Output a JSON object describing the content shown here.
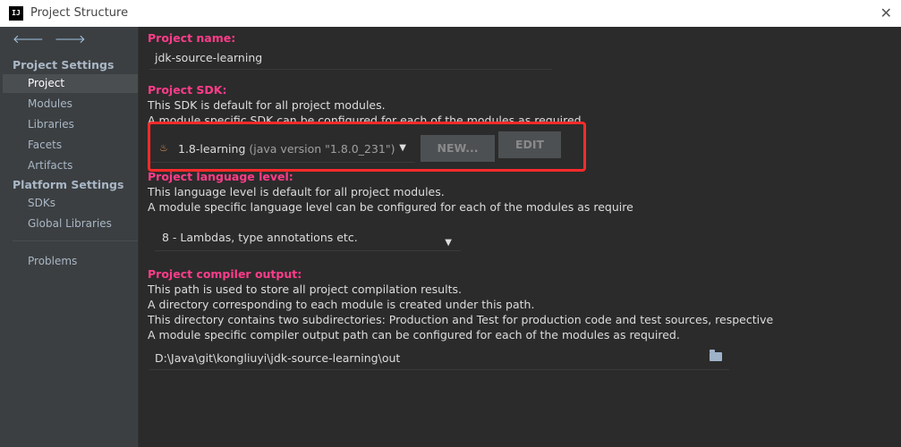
{
  "window": {
    "title": "Project Structure",
    "app_icon": "IJ",
    "close_glyph": "✕"
  },
  "nav": {
    "back": "🡐",
    "forward": "🡒"
  },
  "sidebar": {
    "project_settings_header": "Project Settings",
    "project_settings_items": [
      "Project",
      "Modules",
      "Libraries",
      "Facets",
      "Artifacts"
    ],
    "platform_settings_header": "Platform Settings",
    "platform_settings_items": [
      "SDKs",
      "Global Libraries"
    ],
    "other_items": [
      "Problems"
    ],
    "selected": "Project"
  },
  "project_name": {
    "label": "Project name:",
    "value": "jdk-source-learning"
  },
  "project_sdk": {
    "label": "Project SDK:",
    "desc1": "This SDK is default for all project modules.",
    "desc2": "A module specific SDK can be configured for each of the modules as required.",
    "selected_name": "1.8-learning",
    "selected_version": "(java version \"1.8.0_231\")",
    "new_button": "NEW...",
    "edit_button": "EDIT"
  },
  "language_level": {
    "label": "Project language level:",
    "desc1": "This language level is default for all project modules.",
    "desc2": "A module specific language level can be configured for each of the modules as require",
    "value": "8 - Lambdas, type annotations etc."
  },
  "compiler_output": {
    "label": "Project compiler output:",
    "desc1": "This path is used to store all project compilation results.",
    "desc2": "A directory corresponding to each module is created under this path.",
    "desc3": "This directory contains two subdirectories: Production and Test for production code and test sources, respective",
    "desc4": "A module specific compiler output path can be configured for each of the modules as required.",
    "path": "D:\\Java\\git\\kongliuyi\\jdk-source-learning\\out"
  },
  "colors": {
    "label_accent": "#ff3c8a",
    "highlight_box": "#ff2b2b",
    "background": "#2b2b2b",
    "sidebar": "#3c3f41"
  }
}
